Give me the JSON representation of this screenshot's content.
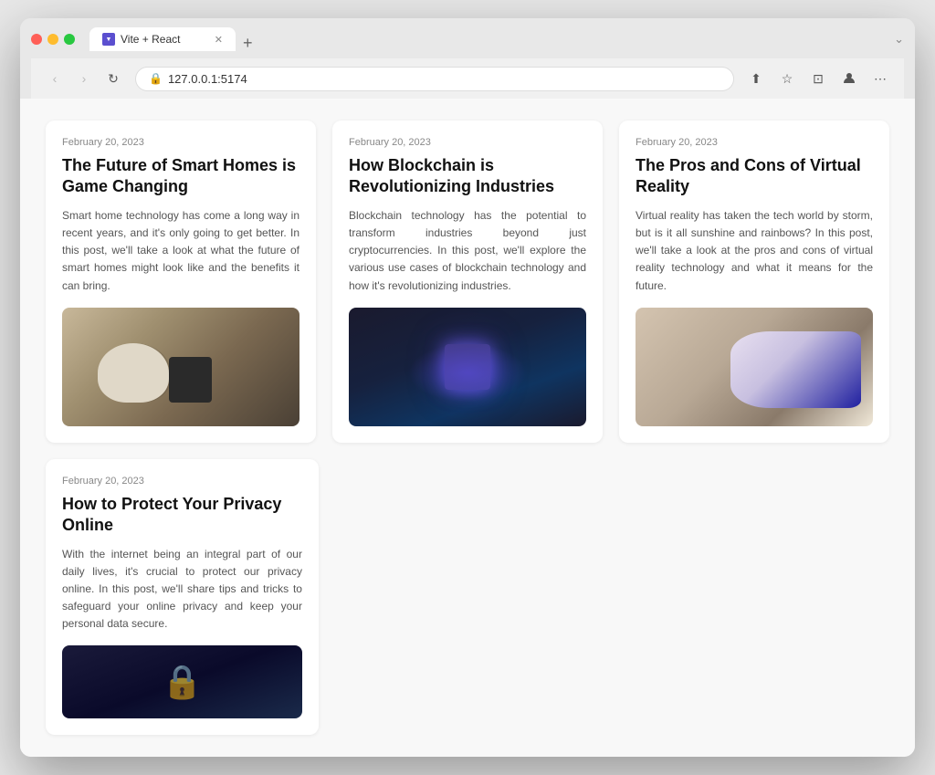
{
  "browser": {
    "tab_title": "Vite + React",
    "url": "127.0.0.1:5174",
    "url_protocol": "127.0.0.1:5174",
    "new_tab_button": "+",
    "tab_close": "✕"
  },
  "nav": {
    "back": "‹",
    "forward": "›",
    "reload": "↻"
  },
  "toolbar_icons": {
    "share": "⬆",
    "bookmark": "☆",
    "reader": "⊡",
    "profile": "👤",
    "more": "⋯"
  },
  "cards": [
    {
      "date": "February 20, 2023",
      "title": "The Future of Smart Homes is Game Changing",
      "excerpt": "Smart home technology has come a long way in recent years, and it's only going to get better. In this post, we'll take a look at what the future of smart homes might look like and the benefits it can bring.",
      "image_type": "smart-home"
    },
    {
      "date": "February 20, 2023",
      "title": "How Blockchain is Revolutionizing Industries",
      "excerpt": "Blockchain technology has the potential to transform industries beyond just cryptocurrencies. In this post, we'll explore the various use cases of blockchain technology and how it's revolutionizing industries.",
      "image_type": "blockchain"
    },
    {
      "date": "February 20, 2023",
      "title": "The Pros and Cons of Virtual Reality",
      "excerpt": "Virtual reality has taken the tech world by storm, but is it all sunshine and rainbows? In this post, we'll take a look at the pros and cons of virtual reality technology and what it means for the future.",
      "image_type": "vr"
    }
  ],
  "bottom_cards": [
    {
      "date": "February 20, 2023",
      "title": "How to Protect Your Privacy Online",
      "excerpt": "With the internet being an integral part of our daily lives, it's crucial to protect our privacy online. In this post, we'll share tips and tricks to safeguard your online privacy and keep your personal data secure.",
      "image_type": "privacy"
    }
  ]
}
